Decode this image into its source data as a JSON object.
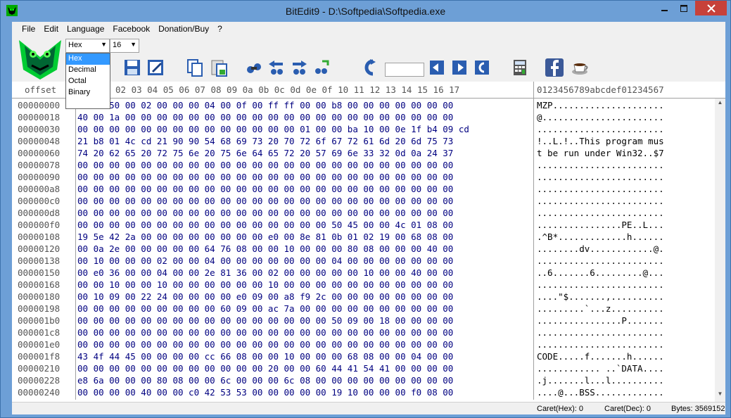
{
  "window": {
    "title": "BitEdit9 - D:\\Softpedia\\Softpedia.exe"
  },
  "menu": [
    "File",
    "Edit",
    "Language",
    "Facebook",
    "Donation/Buy",
    "?"
  ],
  "toolbar": {
    "base_value": "Hex",
    "width_value": "16",
    "base_options": [
      "Hex",
      "Decimal",
      "Octal",
      "Binary"
    ],
    "icons": [
      "save-icon",
      "edit-icon",
      "copy-icon",
      "paste-icon",
      "find-icon",
      "find-prev-icon",
      "find-next-icon",
      "replace-icon",
      "goto-icon",
      "goto-next-icon",
      "goto-prev-icon",
      "goto-back-icon",
      "calculator-icon",
      "facebook-icon",
      "coffee-icon"
    ]
  },
  "editor": {
    "header_offset": "offset",
    "header_cols": [
      "02",
      "03",
      "04",
      "05",
      "06",
      "07",
      "08",
      "09",
      "0a",
      "0b",
      "0c",
      "0d",
      "0e",
      "0f",
      "10",
      "11",
      "12",
      "13",
      "14",
      "15",
      "16",
      "17"
    ],
    "header_ascii": "0123456789abcdef01234567",
    "rows": [
      {
        "off": "00000000",
        "hex": "4d 5a 50 00 02 00 00 00 04 00 0f 00 ff ff 00 00 b8 00 00 00 00 00 00 00",
        "asc": "MZP....................."
      },
      {
        "off": "00000018",
        "hex": "40 00 1a 00 00 00 00 00 00 00 00 00 00 00 00 00 00 00 00 00 00 00 00 00",
        "asc": "@......................."
      },
      {
        "off": "00000030",
        "hex": "00 00 00 00 00 00 00 00 00 00 00 00 00 00 01 00 00 ba 10 00 0e 1f b4 09 cd",
        "asc": "........................"
      },
      {
        "off": "00000048",
        "hex": "21 b8 01 4c cd 21 90 90 54 68 69 73 20 70 72 6f 67 72 61 6d 20 6d 75 73",
        "asc": "!..L.!..This program mus"
      },
      {
        "off": "00000060",
        "hex": "74 20 62 65 20 72 75 6e 20 75 6e 64 65 72 20 57 69 6e 33 32 0d 0a 24 37",
        "asc": "t be run under Win32..$7"
      },
      {
        "off": "00000078",
        "hex": "00 00 00 00 00 00 00 00 00 00 00 00 00 00 00 00 00 00 00 00 00 00 00 00",
        "asc": "........................"
      },
      {
        "off": "00000090",
        "hex": "00 00 00 00 00 00 00 00 00 00 00 00 00 00 00 00 00 00 00 00 00 00 00 00",
        "asc": "........................"
      },
      {
        "off": "000000a8",
        "hex": "00 00 00 00 00 00 00 00 00 00 00 00 00 00 00 00 00 00 00 00 00 00 00 00",
        "asc": "........................"
      },
      {
        "off": "000000c0",
        "hex": "00 00 00 00 00 00 00 00 00 00 00 00 00 00 00 00 00 00 00 00 00 00 00 00",
        "asc": "........................"
      },
      {
        "off": "000000d8",
        "hex": "00 00 00 00 00 00 00 00 00 00 00 00 00 00 00 00 00 00 00 00 00 00 00 00",
        "asc": "........................"
      },
      {
        "off": "000000f0",
        "hex": "00 00 00 00 00 00 00 00 00 00 00 00 00 00 00 00 50 45 00 00 4c 01 08 00",
        "asc": "................PE..L..."
      },
      {
        "off": "00000108",
        "hex": "19 5e 42 2a 00 00 00 00 00 00 00 00 e0 00 8e 81 0b 01 02 19 00 68 08 00",
        "asc": ".^B*.............h......"
      },
      {
        "off": "00000120",
        "hex": "00 0a 2e 00 00 00 00 00 64 76 08 00 00 10 00 00 00 80 08 00 00 00 40 00",
        "asc": "........dv............@."
      },
      {
        "off": "00000138",
        "hex": "00 10 00 00 00 02 00 00 04 00 00 00 00 00 00 00 04 00 00 00 00 00 00 00",
        "asc": "........................"
      },
      {
        "off": "00000150",
        "hex": "00 e0 36 00 00 04 00 00 2e 81 36 00 02 00 00 00 00 00 10 00 00 40 00 00",
        "asc": "..6.......6.........@..."
      },
      {
        "off": "00000168",
        "hex": "00 00 10 00 00 10 00 00 00 00 00 00 10 00 00 00 00 00 00 00 00 00 00 00",
        "asc": "........................"
      },
      {
        "off": "00000180",
        "hex": "00 10 09 00 22 24 00 00 00 00 e0 09 00 a8 f9 2c 00 00 00 00 00 00 00 00",
        "asc": "....\"$.......,.........."
      },
      {
        "off": "00000198",
        "hex": "00 00 00 00 00 00 00 00 00 60 09 00 ac 7a 00 00 00 00 00 00 00 00 00 00",
        "asc": ".........`...z.........."
      },
      {
        "off": "000001b0",
        "hex": "00 00 00 00 00 00 00 00 00 00 00 00 00 00 00 00 50 09 00 18 00 00 00 00",
        "asc": "................P......."
      },
      {
        "off": "000001c8",
        "hex": "00 00 00 00 00 00 00 00 00 00 00 00 00 00 00 00 00 00 00 00 00 00 00 00",
        "asc": "........................"
      },
      {
        "off": "000001e0",
        "hex": "00 00 00 00 00 00 00 00 00 00 00 00 00 00 00 00 00 00 00 00 00 00 00 00",
        "asc": "........................"
      },
      {
        "off": "000001f8",
        "hex": "43 4f 44 45 00 00 00 00 cc 66 08 00 00 10 00 00 00 68 08 00 00 04 00 00",
        "asc": "CODE.....f.......h......"
      },
      {
        "off": "00000210",
        "hex": "00 00 00 00 00 00 00 00 00 00 00 00 20 00 00 60 44 41 54 41 00 00 00 00",
        "asc": "............ ..`DATA...."
      },
      {
        "off": "00000228",
        "hex": "e8 6a 00 00 00 80 08 00 00 6c 00 00 00 6c 08 00 00 00 00 00 00 00 00 00",
        "asc": ".j.......l...l.........."
      },
      {
        "off": "00000240",
        "hex": "00 00 00 00 40 00 00 c0 42 53 53 00 00 00 00 00 19 10 00 00 00 f0 08 00",
        "asc": "....@...BSS............."
      }
    ]
  },
  "status": {
    "caret_hex": "Caret(Hex): 0",
    "caret_dec": "Caret(Dec): 0",
    "bytes": "Bytes: 3569152"
  },
  "colors": {
    "title_bar": "#6d9fd6",
    "close": "#c7413a",
    "hex_text": "#000080",
    "selection": "#3399ff"
  }
}
